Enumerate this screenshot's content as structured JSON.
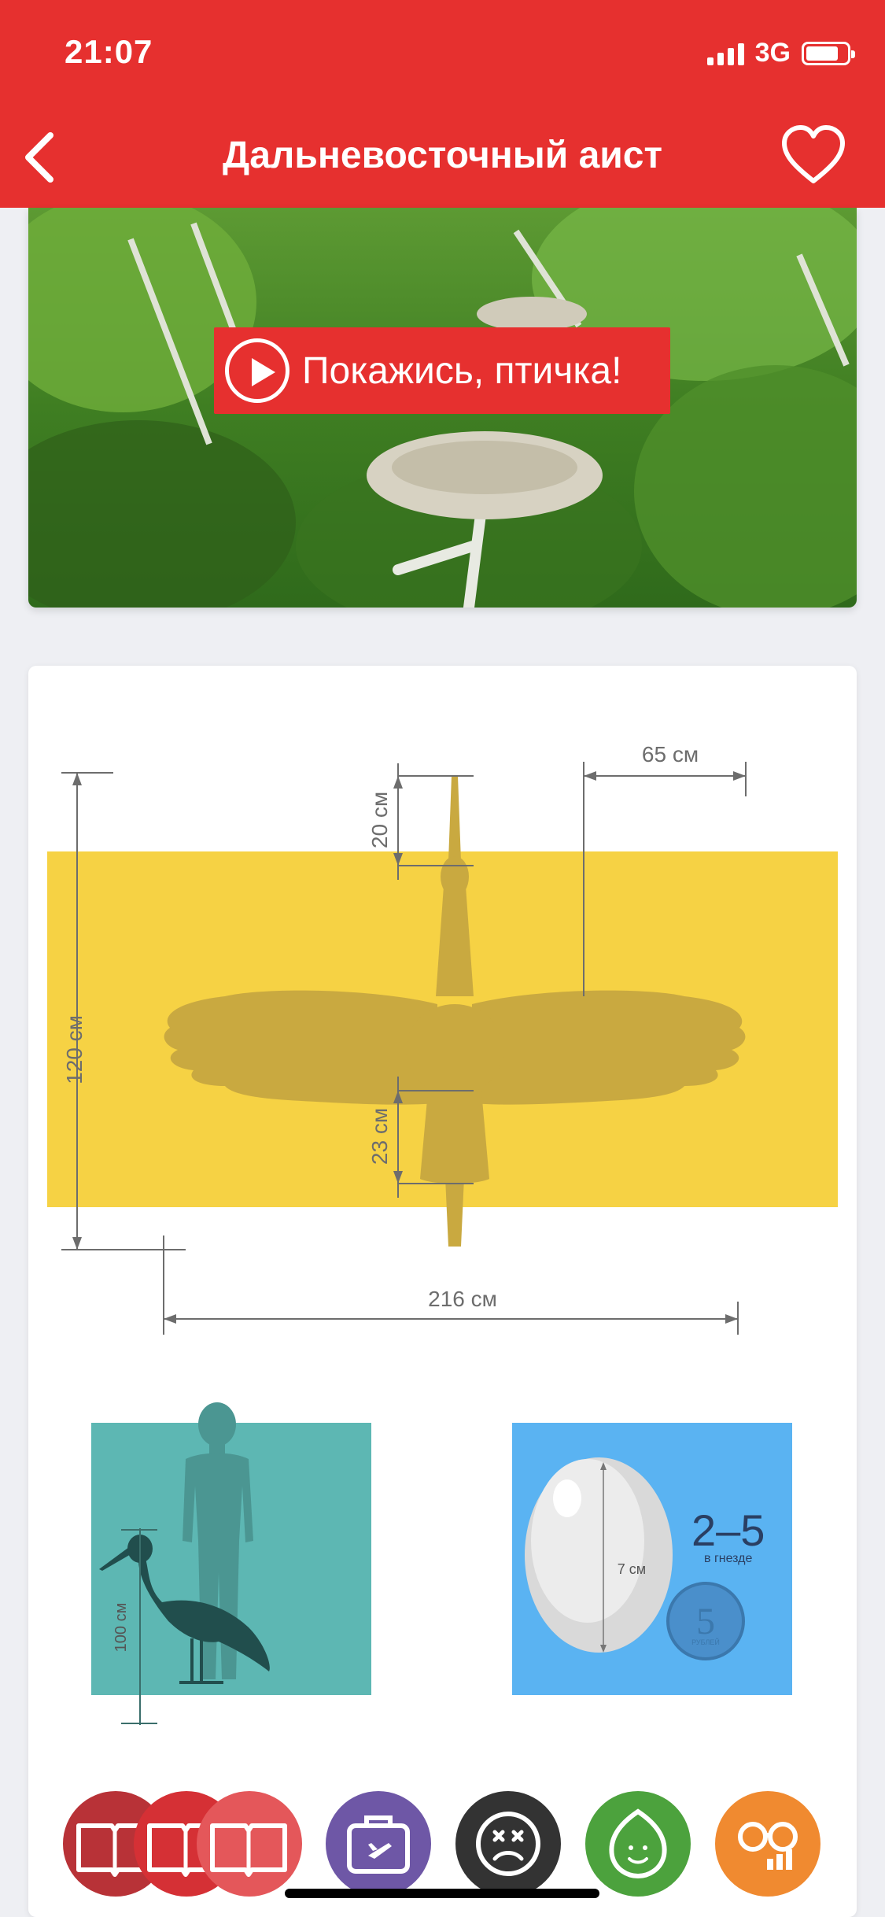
{
  "status_bar": {
    "time": "21:07",
    "network": "3G"
  },
  "header": {
    "title": "Дальневосточный аист"
  },
  "video": {
    "label": "Покажись, птичка!"
  },
  "size_diagram": {
    "length": "120 см",
    "wingspan": "216 см",
    "beak": "20 см",
    "tail": "23 см",
    "wing_width": "65 см"
  },
  "height_comparison": {
    "height": "100 см"
  },
  "eggs": {
    "egg_size": "7 см",
    "count": "2–5",
    "count_label": "в гнезде",
    "coin_value": "5",
    "coin_label": "РУБЛЕЙ"
  },
  "colors": {
    "accent": "#e6302f",
    "size_band": "#f6d244",
    "bird_silhouette": "#c9a940",
    "height_panel": "#5db7b3",
    "egg_panel": "#5ab3f2",
    "nav_info": "#c72f34",
    "nav_migration": "#6e57a6",
    "nav_threats": "#333333",
    "nav_ecology": "#4ca23d",
    "nav_observe": "#f08a30"
  },
  "bottom_nav": [
    {
      "icon": "book-icon"
    },
    {
      "icon": "suitcase-plane-icon"
    },
    {
      "icon": "sad-face-icon"
    },
    {
      "icon": "leaf-icon"
    },
    {
      "icon": "binoculars-icon"
    }
  ]
}
